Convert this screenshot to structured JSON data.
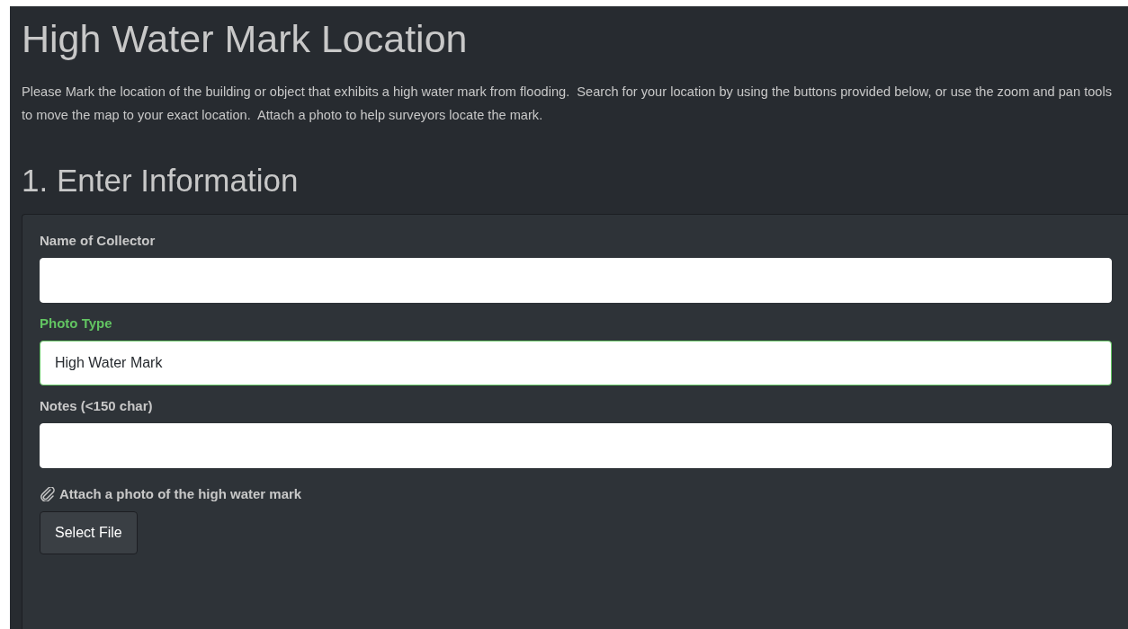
{
  "title": "High Water Mark Location",
  "intro": "Please Mark the location of the building or object that exhibits a high water mark from flooding.  Search for your location by using the buttons provided below, or use the zoom and pan tools to move the map to your exact location.  Attach a photo to help surveyors locate the mark.",
  "section": "1. Enter Information",
  "fields": [
    {
      "label": "Name of Collector",
      "valid": false
    },
    {
      "label": "Photo Type",
      "value": "High Water Mark",
      "valid": true
    },
    {
      "label": "Notes (<150 char)",
      "valid": false
    }
  ],
  "attachment": {
    "label": "Attach a photo of the high water mark",
    "button": "Select File"
  }
}
